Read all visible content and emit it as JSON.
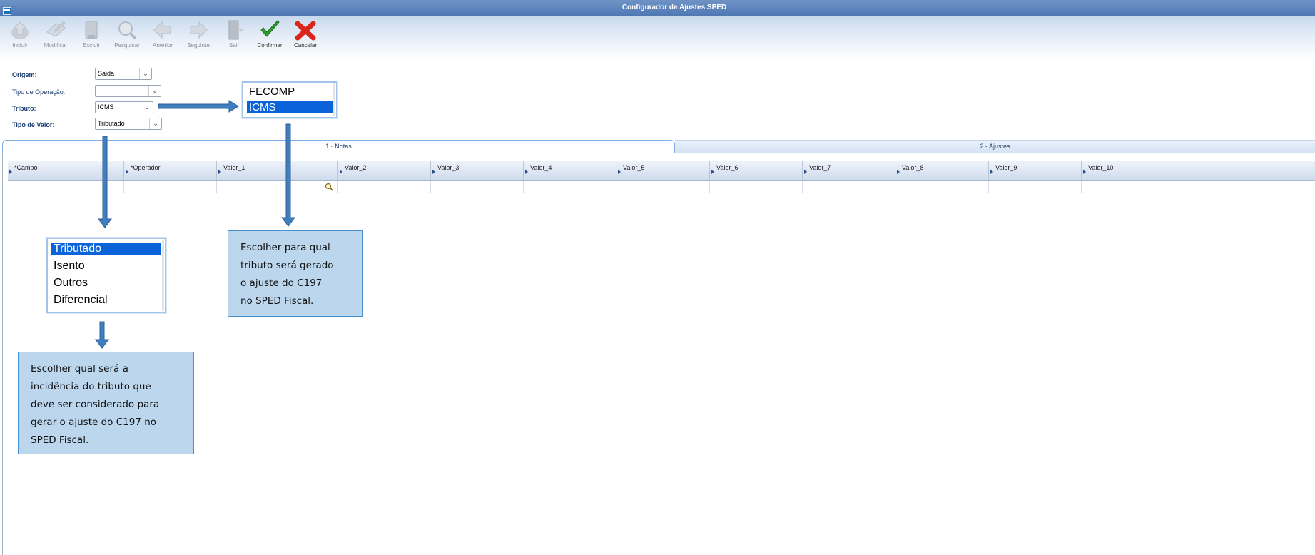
{
  "window": {
    "title": "Configurador de Ajustes SPED"
  },
  "toolbar": {
    "buttons": [
      {
        "label": "Incluir",
        "icon": "add-icon",
        "enabled": false
      },
      {
        "label": "Modificar",
        "icon": "edit-icon",
        "enabled": false
      },
      {
        "label": "Excluir",
        "icon": "trash-icon",
        "enabled": false
      },
      {
        "label": "Pesquisar",
        "icon": "search-icon",
        "enabled": false
      },
      {
        "label": "Anterior",
        "icon": "arrow-left-icon",
        "enabled": false
      },
      {
        "label": "Seguinte",
        "icon": "arrow-right-icon",
        "enabled": false
      },
      {
        "label": "Sair",
        "icon": "exit-door-icon",
        "enabled": false
      },
      {
        "label": "Confirmar",
        "icon": "checkmark-icon",
        "enabled": true
      },
      {
        "label": "Cancelar",
        "icon": "red-x-icon",
        "enabled": true
      }
    ]
  },
  "form": {
    "origem": {
      "label": "Origem:",
      "value": "Saida"
    },
    "tipo_operacao": {
      "label": "Tipo de Operação:",
      "value": ""
    },
    "tributo": {
      "label": "Tributo:",
      "value": "ICMS"
    },
    "tipo_valor": {
      "label": "Tipo de Valor:",
      "value": "Tributado"
    }
  },
  "tabs": [
    {
      "label": "1 - Notas",
      "active": true
    },
    {
      "label": "2 - Ajustes",
      "active": false
    }
  ],
  "grid": {
    "columns": [
      "*Campo",
      "*Operador",
      "Valor_1",
      "",
      "Valor_2",
      "Valor_3",
      "Valor_4",
      "Valor_5",
      "Valor_6",
      "Valor_7",
      "Valor_8",
      "Valor_9",
      "Valor_10"
    ]
  },
  "dropdowns": {
    "tributo_options": {
      "items": [
        "FECOMP",
        "ICMS"
      ],
      "selected": "ICMS"
    },
    "tipo_valor_options": {
      "items": [
        "Tributado",
        "Isento",
        "Outros",
        "Diferencial"
      ],
      "selected": "Tributado"
    }
  },
  "callouts": {
    "tributo": "Escolher para qual\ntributo será gerado\no ajuste do C197\nno SPED Fiscal.",
    "tipo_valor": "Escolher qual será a\nincidência do tributo que\ndeve ser considerado para\ngerar o ajuste do C197 no\nSPED Fiscal."
  },
  "colors": {
    "accent": "#1f6fb5",
    "selection": "#0a63d8",
    "callout_bg": "#bcd6ee",
    "arrow": "#3f7fc0"
  }
}
